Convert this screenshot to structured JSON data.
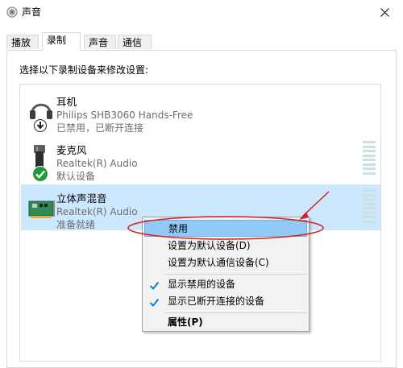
{
  "window": {
    "title": "声音"
  },
  "tabs": [
    {
      "label": "播放"
    },
    {
      "label": "录制"
    },
    {
      "label": "声音"
    },
    {
      "label": "通信"
    }
  ],
  "instruction": "选择以下录制设备来修改设置:",
  "devices": [
    {
      "name": "耳机",
      "driver": "Philips SHB3060 Hands-Free",
      "status": "已禁用，已断开连接",
      "icon": "headset-icon",
      "badge": "down-arrow-badge"
    },
    {
      "name": "麦克风",
      "driver": "Realtek(R) Audio",
      "status": "默认设备",
      "icon": "microphone-icon",
      "badge": "green-check-badge"
    },
    {
      "name": "立体声混音",
      "driver": "Realtek(R) Audio",
      "status": "准备就绪",
      "icon": "sound-card-icon",
      "selected": true
    }
  ],
  "context_menu": {
    "items": [
      {
        "label": "禁用",
        "highlighted": true
      },
      {
        "label": "设置为默认设备(D)"
      },
      {
        "label": "设置为默认通信设备(C)"
      },
      {
        "label": "显示禁用的设备",
        "checked": true
      },
      {
        "label": "显示已断开连接的设备",
        "checked": true
      },
      {
        "label": "属性(P)",
        "bold": true
      }
    ]
  },
  "colors": {
    "selection": "#cce8ff",
    "menu_highlight": "#91c9f7",
    "check": "#0078d7",
    "annotation": "#d62020"
  }
}
